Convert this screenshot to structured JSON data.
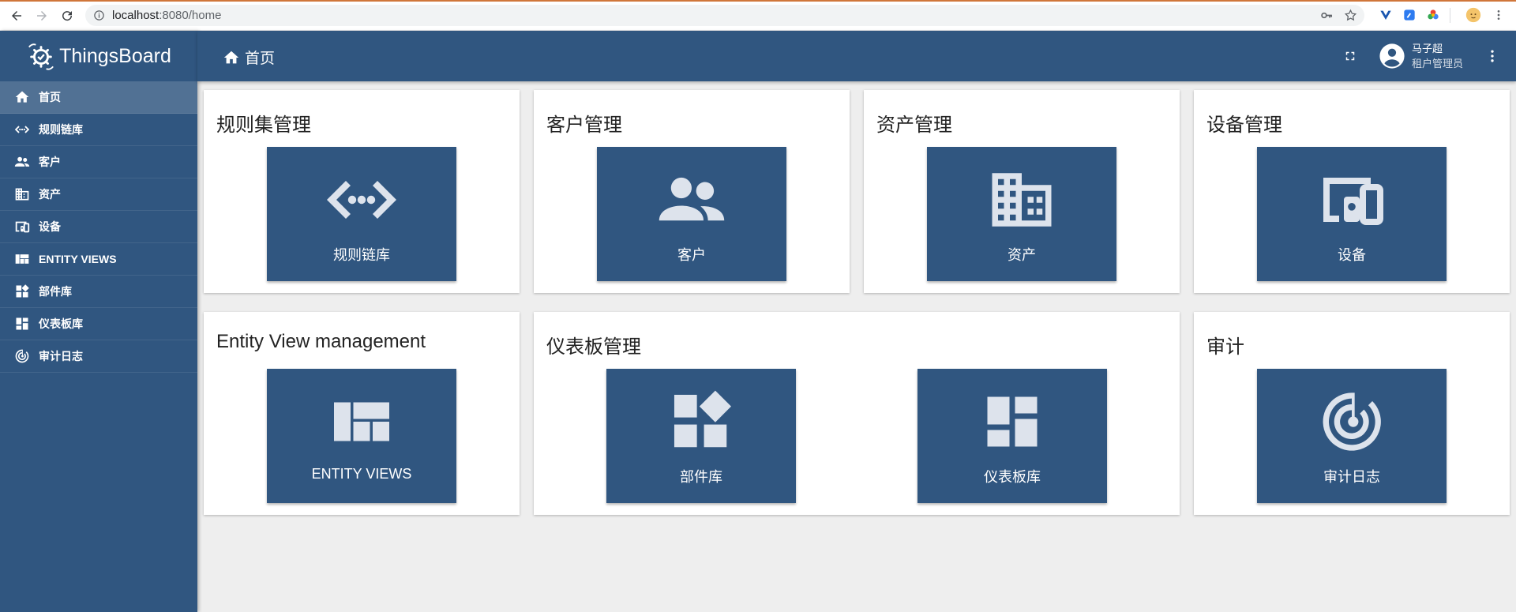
{
  "browser": {
    "url_host": "localhost",
    "url_rest": ":8080/home"
  },
  "sidebar": {
    "brand": "ThingsBoard",
    "items": [
      {
        "label": "首页",
        "icon": "home-icon",
        "active": true
      },
      {
        "label": "规则链库",
        "icon": "code-arrows-icon"
      },
      {
        "label": "客户",
        "icon": "people-icon"
      },
      {
        "label": "资产",
        "icon": "building-icon"
      },
      {
        "label": "设备",
        "icon": "devices-icon"
      },
      {
        "label": "ENTITY VIEWS",
        "icon": "view-quilt-icon"
      },
      {
        "label": "部件库",
        "icon": "widgets-icon"
      },
      {
        "label": "仪表板库",
        "icon": "dashboard-icon"
      },
      {
        "label": "审计日志",
        "icon": "track-changes-icon"
      }
    ]
  },
  "header": {
    "breadcrumb": "首页",
    "user_name": "马子超",
    "user_role": "租户管理员"
  },
  "cards": [
    {
      "title": "规则集管理",
      "tiles": [
        {
          "label": "规则链库",
          "icon": "code-arrows-icon"
        }
      ]
    },
    {
      "title": "客户管理",
      "tiles": [
        {
          "label": "客户",
          "icon": "people-icon"
        }
      ]
    },
    {
      "title": "资产管理",
      "tiles": [
        {
          "label": "资产",
          "icon": "building-icon"
        }
      ]
    },
    {
      "title": "设备管理",
      "tiles": [
        {
          "label": "设备",
          "icon": "devices-icon"
        }
      ]
    },
    {
      "title": "Entity View management",
      "tiles": [
        {
          "label": "ENTITY VIEWS",
          "icon": "view-quilt-icon"
        }
      ]
    },
    {
      "title": "仪表板管理",
      "tiles": [
        {
          "label": "部件库",
          "icon": "widgets-icon"
        },
        {
          "label": "仪表板库",
          "icon": "dashboard-icon"
        }
      ]
    },
    {
      "title": "审计",
      "tiles": [
        {
          "label": "审计日志",
          "icon": "track-changes-icon"
        }
      ]
    }
  ],
  "colors": {
    "primary": "#305680",
    "background": "#eeeeee",
    "icon_light": "#dde3ec"
  }
}
